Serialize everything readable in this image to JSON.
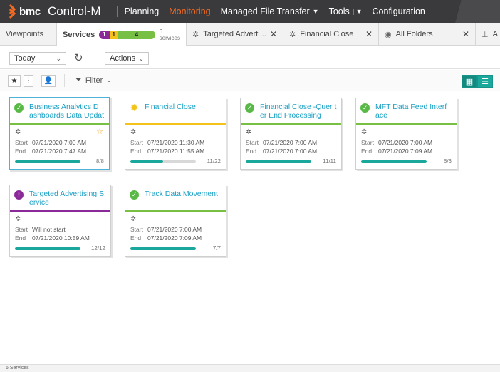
{
  "header": {
    "brand": "bmc",
    "product": "Control-M",
    "nav": [
      {
        "label": "Planning"
      },
      {
        "label": "Monitoring"
      },
      {
        "label": "Managed File Transfer"
      },
      {
        "label": "Tools"
      },
      {
        "label": "Configuration"
      }
    ]
  },
  "tabs": {
    "viewpoints": "Viewpoints",
    "services": "Services",
    "services_badges": [
      "1",
      "1",
      "4"
    ],
    "services_count_num": "6",
    "services_count_lbl": "services",
    "targeted": "Targeted Adverti...",
    "financial": "Financial Close",
    "all_folders": "All Folders",
    "extra": "A"
  },
  "toolbar": {
    "date_select": "Today",
    "actions": "Actions",
    "filter": "Filter"
  },
  "cards": [
    {
      "title": "Business Analytics D ashboards Data Updates",
      "status": "ok",
      "bar": "green",
      "start": "07/21/2020 7:00 AM",
      "end": "07/21/2020 7:47 AM",
      "count": "8/8",
      "progress": 1.0
    },
    {
      "title": "Financial Close",
      "status": "running",
      "bar": "yellow",
      "start": "07/21/2020 11:30 AM",
      "end": "07/21/2020 11:55 AM",
      "count": "11/22",
      "progress": 0.5
    },
    {
      "title": "Financial Close -Quer ter End Processing",
      "status": "ok",
      "bar": "green",
      "start": "07/21/2020 7:00 AM",
      "end": "07/21/2020 7:00 AM",
      "count": "11/11",
      "progress": 1.0
    },
    {
      "title": "MFT Data Feed Interf ace",
      "status": "ok",
      "bar": "green",
      "start": "07/21/2020 7:00 AM",
      "end": "07/21/2020 7:09 AM",
      "count": "6/6",
      "progress": 1.0
    },
    {
      "title": "Targeted Advertising Service",
      "status": "warning",
      "bar": "purple",
      "start": "Will not start",
      "end": "07/21/2020 10:59 AM",
      "count": "12/12",
      "progress": 1.0
    },
    {
      "title": "Track Data Movement",
      "status": "ok",
      "bar": "green",
      "start": "07/21/2020 7:00 AM",
      "end": "07/21/2020 7:09 AM",
      "count": "7/7",
      "progress": 1.0
    }
  ],
  "labels": {
    "start": "Start",
    "end": "End"
  },
  "footer": {
    "status": "6 Services"
  },
  "colors": {
    "accent": "#f26a22",
    "teal": "#1ba89c",
    "link": "#1aa0c4",
    "ok": "#77c043",
    "warn": "#f3c21b",
    "error": "#8a2a99"
  }
}
